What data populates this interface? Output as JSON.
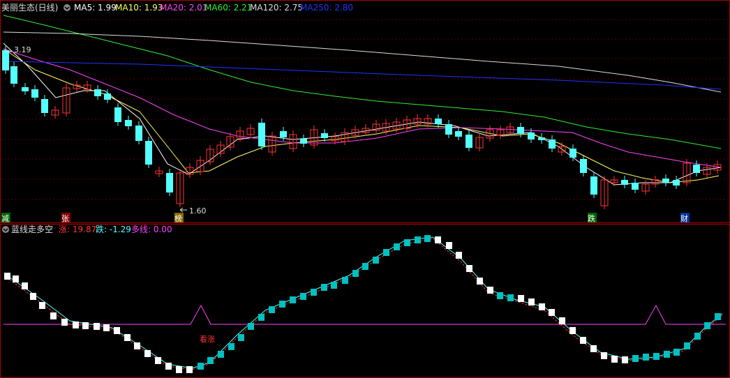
{
  "main_panel": {
    "stock_title": "美丽生态(日线)",
    "indicators": [
      {
        "label": "MA5: 1.99",
        "color": "#ffffff"
      },
      {
        "label": "MA10: 1.93",
        "color": "#ffff66"
      },
      {
        "label": "MA20: 2.01",
        "color": "#ff44ff"
      },
      {
        "label": "MA60: 2.21",
        "color": "#33ee33"
      },
      {
        "label": "MA120: 2.75",
        "color": "#dddddd"
      },
      {
        "label": "MA250: 2.80",
        "color": "#2233ff"
      }
    ],
    "price_high_label": "3.19",
    "price_low_label": "1.60",
    "event_tags": [
      "减",
      "张",
      "榜",
      "跌",
      "财"
    ],
    "up_color": "#ff3333",
    "down_color": "#54ffff"
  },
  "sub_panel": {
    "title": "蓝线走多空",
    "indicators": [
      {
        "label": "涨: 19.87",
        "color": "#ff3333"
      },
      {
        "label": "跌: -1.29",
        "color": "#54ffff"
      },
      {
        "label": "多线: 0.00",
        "color": "#ff44ff"
      }
    ],
    "signal_label": "看涨",
    "bar_color_up": "#00c0c0",
    "bar_color_down": "#ffffff"
  }
}
